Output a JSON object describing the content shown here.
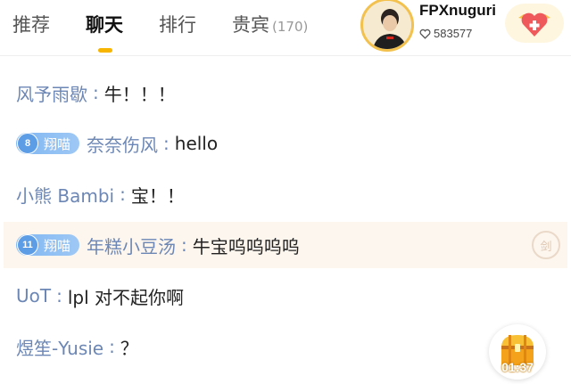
{
  "header": {
    "tabs": [
      {
        "label": "推荐",
        "active": false
      },
      {
        "label": "聊天",
        "active": true
      },
      {
        "label": "排行",
        "active": false
      },
      {
        "label": "贵宾",
        "active": false,
        "count": "(170)"
      }
    ],
    "anchor": {
      "name": "FPXnuguri",
      "heat": "583577",
      "heat_icon": "heart-outline-icon",
      "guard_icon": "guard-heart-icon"
    }
  },
  "chat": {
    "messages": [
      {
        "user": "风予雨歇",
        "sep": ":",
        "text": "牛！！！",
        "badge": null,
        "highlight": false
      },
      {
        "user": "奈奈伤风",
        "sep": ":",
        "text": "hello",
        "badge": {
          "level": "8",
          "name": "翔喵"
        },
        "highlight": false
      },
      {
        "user": "小熊 Bambi",
        "sep": ":",
        "text": "宝！！",
        "badge": null,
        "highlight": false
      },
      {
        "user": "年糕小豆汤",
        "sep": ":",
        "text": "牛宝呜呜呜呜",
        "badge": {
          "level": "11",
          "name": "翔喵"
        },
        "highlight": true,
        "side_icon": "剑"
      },
      {
        "user": "UoT",
        "sep": ":",
        "text": "lpl 对不起你啊",
        "badge": null,
        "highlight": false
      },
      {
        "user": "煜笙-Yusie",
        "sep": ":",
        "text": "？",
        "badge": null,
        "highlight": false
      }
    ]
  },
  "chest": {
    "timer": "01:37",
    "icon": "treasure-chest-icon"
  },
  "colors": {
    "accent": "#f7b500",
    "username": "#6c87b5",
    "fan_badge": "#7fb6f2",
    "highlight_bg": "#fdf6ee"
  }
}
